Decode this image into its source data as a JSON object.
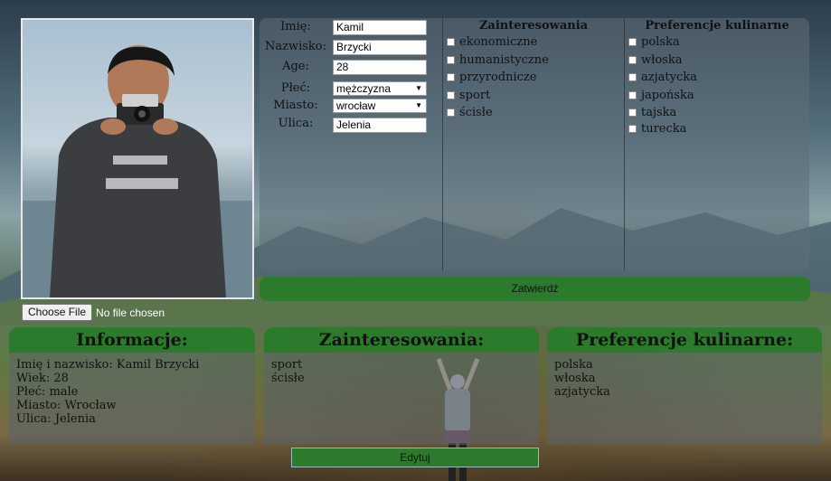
{
  "form": {
    "fields": [
      {
        "label": "Imię:",
        "value": "Kamil"
      },
      {
        "label": "Nazwisko:",
        "value": "Brzycki"
      },
      {
        "label": "Age:",
        "value": "28"
      }
    ],
    "selects": [
      {
        "label": "Płeć:",
        "value": "mężczyzna"
      },
      {
        "label": "Miasto:",
        "value": "wrocław"
      }
    ],
    "street": {
      "label": "Ulica:",
      "value": "Jelenia"
    }
  },
  "interests": {
    "title": "Zainteresowania",
    "items": [
      "ekonomiczne",
      "humanistyczne",
      "przyrodnicze",
      "sport",
      "ścisłe"
    ]
  },
  "cuisine": {
    "title": "Preferencje kulinarne",
    "items": [
      "polska",
      "włoska",
      "azjatycka",
      "japońska",
      "tajska",
      "turecka"
    ]
  },
  "file": {
    "button": "Choose File",
    "status": "No file chosen"
  },
  "submit_label": "Zatwierdź",
  "cards": {
    "info": {
      "title": "Informacje:",
      "lines": [
        "Imię i nazwisko: Kamil Brzycki",
        "Wiek: 28",
        "Płeć: male",
        "Miasto: Wrocław",
        "Ulica: Jelenia"
      ]
    },
    "interests": {
      "title": "Zainteresowania:",
      "lines": [
        "sport",
        "ścisłe"
      ]
    },
    "cuisine": {
      "title": "Preferencje kulinarne:",
      "lines": [
        "polska",
        "włoska",
        "azjatycka"
      ]
    }
  },
  "edit_label": "Edytuj",
  "colors": {
    "accent": "#2c7a2c",
    "panel": "#5f6e78"
  }
}
